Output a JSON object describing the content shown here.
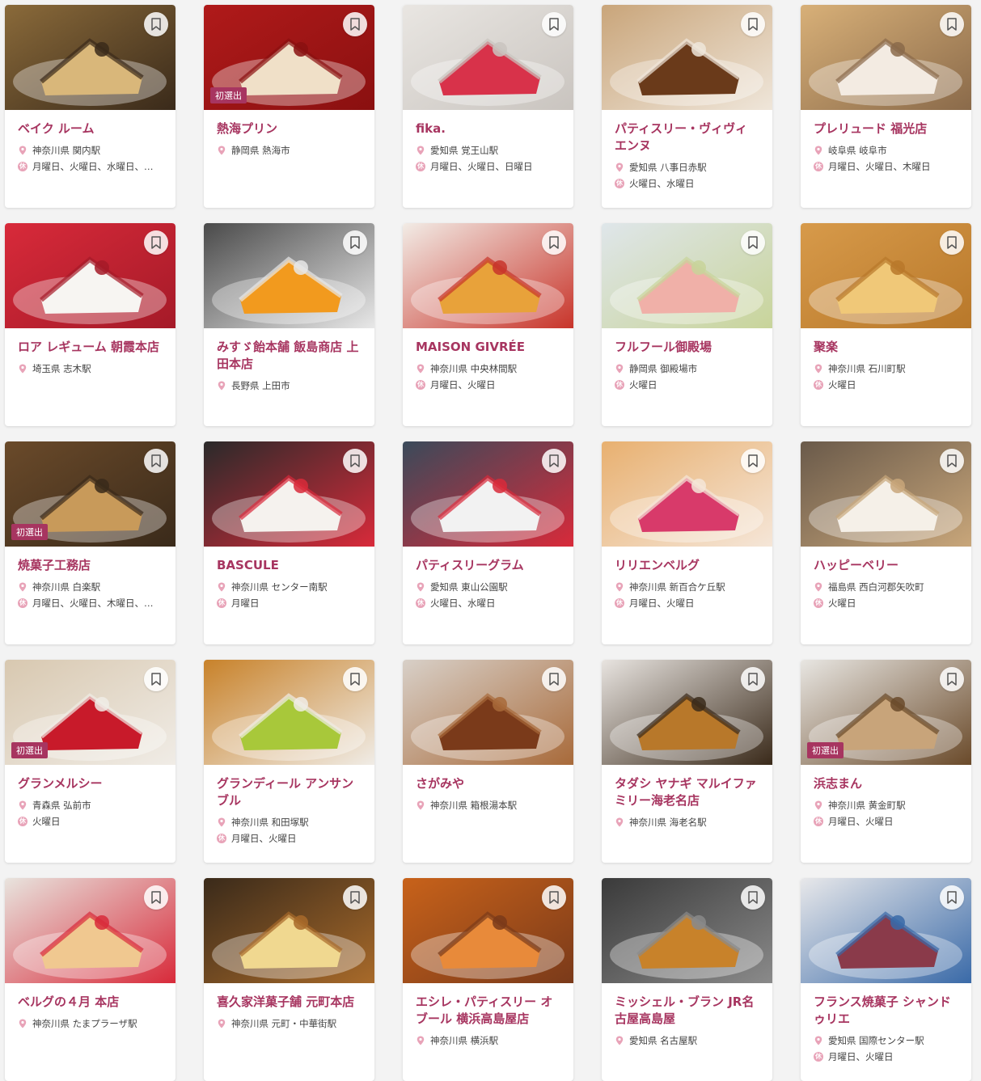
{
  "colors": {
    "accent": "#a73560",
    "badge_bg": "#a73560",
    "icon_pink": "#e8a3b8"
  },
  "icons": {
    "bookmark": "bookmark-icon",
    "location": "map-pin-icon",
    "holiday": "holiday-icon"
  },
  "holiday_icon_text": "休",
  "shops": [
    {
      "name": "ベイク ルーム",
      "location": "神奈川県 関内駅",
      "holidays": "月曜日、火曜日、水曜日、…",
      "badge": "",
      "tone": [
        "#8a6a3a",
        "#d9b77a",
        "#3a2a1a"
      ]
    },
    {
      "name": "熱海プリン",
      "location": "静岡県 熱海市",
      "holidays": "",
      "badge": "初選出",
      "tone": [
        "#b01a1a",
        "#f0e0c8",
        "#8a1010"
      ]
    },
    {
      "name": "fika.",
      "location": "愛知県 覚王山駅",
      "holidays": "月曜日、火曜日、日曜日",
      "badge": "",
      "tone": [
        "#e9e6e2",
        "#d8324a",
        "#c9c4bf"
      ]
    },
    {
      "name": "パティスリー・ヴィヴィエンヌ",
      "location": "愛知県 八事日赤駅",
      "holidays": "火曜日、水曜日",
      "badge": "",
      "tone": [
        "#c9a57a",
        "#6a3a1a",
        "#efe6da"
      ]
    },
    {
      "name": "プレリュード 福光店",
      "location": "岐阜県 岐阜市",
      "holidays": "月曜日、火曜日、木曜日",
      "badge": "",
      "tone": [
        "#d8b078",
        "#f3ebe2",
        "#8a6a4a"
      ]
    },
    {
      "name": "ロア レギューム 朝霞本店",
      "location": "埼玉県 志木駅",
      "holidays": "",
      "badge": "",
      "tone": [
        "#d82a3a",
        "#f7f5f2",
        "#a51a28"
      ]
    },
    {
      "name": "みすゞ飴本舗 飯島商店 上田本店",
      "location": "長野県 上田市",
      "holidays": "",
      "badge": "",
      "tone": [
        "#4a4a4a",
        "#f29a1e",
        "#e8e8e8"
      ]
    },
    {
      "name": "MAISON GIVRÉE",
      "location": "神奈川県 中央林間駅",
      "holidays": "月曜日、火曜日",
      "badge": "",
      "tone": [
        "#f2ece6",
        "#e8a23a",
        "#c8342a"
      ]
    },
    {
      "name": "フルフール御殿場",
      "location": "静岡県 御殿場市",
      "holidays": "火曜日",
      "badge": "",
      "tone": [
        "#dfe6ea",
        "#f0b0a8",
        "#c8d49a"
      ]
    },
    {
      "name": "聚楽",
      "location": "神奈川県 石川町駅",
      "holidays": "火曜日",
      "badge": "",
      "tone": [
        "#d79a4a",
        "#f0c878",
        "#b8782a"
      ]
    },
    {
      "name": "焼菓子工務店",
      "location": "神奈川県 白楽駅",
      "holidays": "月曜日、火曜日、木曜日、…",
      "badge": "初選出",
      "tone": [
        "#6a4a2a",
        "#c89a5a",
        "#3a2a1a"
      ]
    },
    {
      "name": "BASCULE",
      "location": "神奈川県 センター南駅",
      "holidays": "月曜日",
      "badge": "",
      "tone": [
        "#2a2a2a",
        "#f5f2ee",
        "#d82a3a"
      ]
    },
    {
      "name": "パティスリーグラム",
      "location": "愛知県 東山公園駅",
      "holidays": "火曜日、水曜日",
      "badge": "",
      "tone": [
        "#3a4a5a",
        "#f2f2f2",
        "#d82a3a"
      ]
    },
    {
      "name": "リリエンベルグ",
      "location": "神奈川県 新百合ケ丘駅",
      "holidays": "月曜日、火曜日",
      "badge": "",
      "tone": [
        "#e8b070",
        "#d83a6a",
        "#f5e6d8"
      ]
    },
    {
      "name": "ハッピーベリー",
      "location": "福島県 西白河郡矢吹町",
      "holidays": "火曜日",
      "badge": "",
      "tone": [
        "#6a5a4a",
        "#f5f0e8",
        "#c8a67a"
      ]
    },
    {
      "name": "グランメルシー",
      "location": "青森県 弘前市",
      "holidays": "火曜日",
      "badge": "初選出",
      "tone": [
        "#d8c8b0",
        "#c81a2a",
        "#f0ece6"
      ]
    },
    {
      "name": "グランディール アンサンブル",
      "location": "神奈川県 和田塚駅",
      "holidays": "月曜日、火曜日",
      "badge": "",
      "tone": [
        "#c8822a",
        "#a8c83a",
        "#f0ece6"
      ]
    },
    {
      "name": "さがみや",
      "location": "神奈川県 箱根湯本駅",
      "holidays": "",
      "badge": "",
      "tone": [
        "#d8d0c8",
        "#7a3a1a",
        "#a86a3a"
      ]
    },
    {
      "name": "タダシ ヤナギ マルイファミリー海老名店",
      "location": "神奈川県 海老名駅",
      "holidays": "",
      "badge": "",
      "tone": [
        "#e8e4e0",
        "#b8782a",
        "#3a2a1a"
      ]
    },
    {
      "name": "浜志まん",
      "location": "神奈川県 黄金町駅",
      "holidays": "月曜日、火曜日",
      "badge": "初選出",
      "tone": [
        "#e8e6e2",
        "#c8a47a",
        "#6a4a2a"
      ]
    },
    {
      "name": "ベルグの４月 本店",
      "location": "神奈川県 たまプラーザ駅",
      "holidays": "",
      "badge": "",
      "tone": [
        "#e8e4de",
        "#f0c890",
        "#d82a3a"
      ]
    },
    {
      "name": "喜久家洋菓子舗 元町本店",
      "location": "神奈川県 元町・中華街駅",
      "holidays": "",
      "badge": "",
      "tone": [
        "#3a2a1a",
        "#f0d890",
        "#a86a2a"
      ]
    },
    {
      "name": "エシレ・パティスリー オ ブール 横浜高島屋店",
      "location": "神奈川県 横浜駅",
      "holidays": "",
      "badge": "",
      "tone": [
        "#c8621a",
        "#e88a3a",
        "#7a3a1a"
      ]
    },
    {
      "name": "ミッシェル・ブラン JR名古屋高島屋",
      "location": "愛知県 名古屋駅",
      "holidays": "",
      "badge": "",
      "tone": [
        "#3a3a3a",
        "#c8822a",
        "#8a8a8a"
      ]
    },
    {
      "name": "フランス焼菓子 シャンドゥリエ",
      "location": "愛知県 国際センター駅",
      "holidays": "月曜日、火曜日",
      "badge": "",
      "tone": [
        "#e8e8ea",
        "#8a3a4a",
        "#3a6aa8"
      ]
    }
  ]
}
